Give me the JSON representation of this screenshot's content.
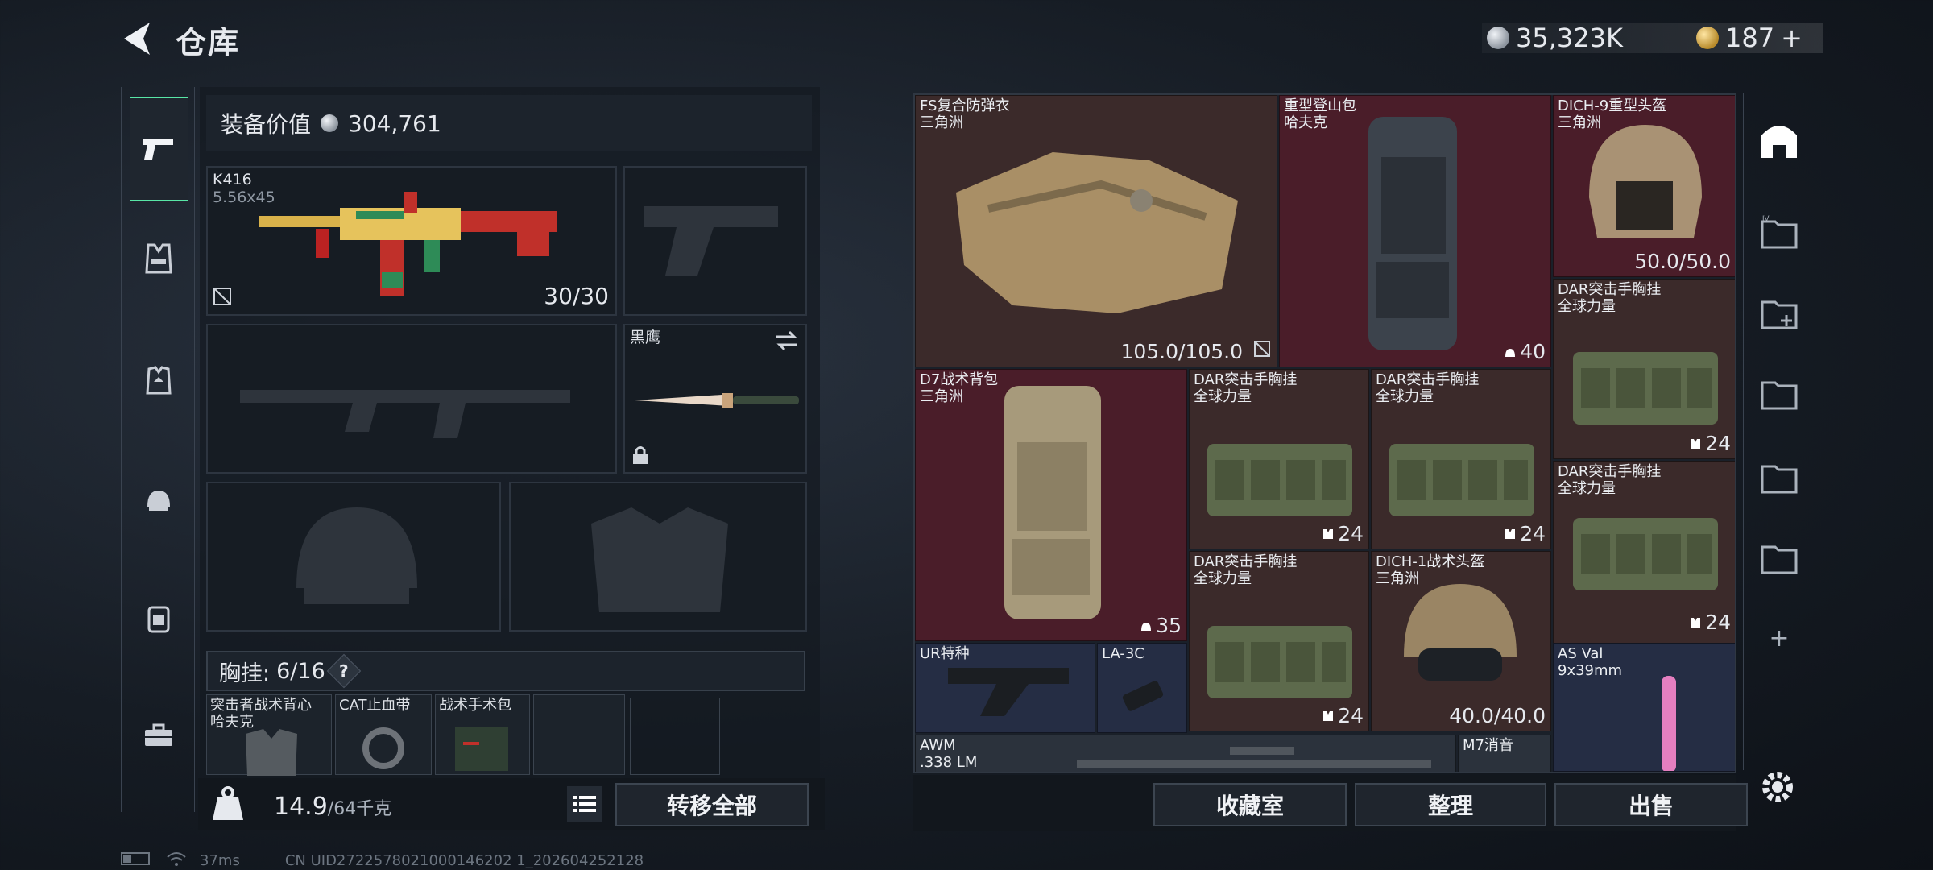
{
  "header": {
    "title": "仓库",
    "currency_silver": "35,323K",
    "currency_gold": "187",
    "gold_plus": "+"
  },
  "loadout": {
    "value_label": "装备价值",
    "value": "304,761",
    "primary_weapon": {
      "name": "K416",
      "caliber": "5.56x45",
      "ammo": "30/30"
    },
    "melee": {
      "name": "黑鹰"
    },
    "chest_rig": {
      "label": "胸挂:",
      "capacity": "6/16",
      "help": "?"
    },
    "chest_items": [
      "突击者战术背心",
      "哈夫克",
      "CAT止血带",
      "战术手术包"
    ],
    "weight": "14.9",
    "weight_max": "/64千克",
    "transfer_all": "转移全部"
  },
  "stash": {
    "items": [
      {
        "name": "FS复合防弹衣",
        "sub": "三角洲",
        "count": "105.0/105.0"
      },
      {
        "name": "重型登山包",
        "sub": "哈夫克",
        "count": "40"
      },
      {
        "name": "DICH-9重型头盔",
        "sub": "三角洲",
        "count": "50.0/50.0"
      },
      {
        "name": "DAR突击手胸挂",
        "sub": "全球力量",
        "count": "24"
      },
      {
        "name": "D7战术背包",
        "sub": "三角洲",
        "count": "35"
      },
      {
        "name": "DAR突击手胸挂",
        "sub": "全球力量",
        "count": "24"
      },
      {
        "name": "DAR突击手胸挂",
        "sub": "全球力量",
        "count": "24"
      },
      {
        "name": "DAR突击手胸挂",
        "sub": "全球力量",
        "count": "24"
      },
      {
        "name": "DAR突击手胸挂",
        "sub": "全球力量",
        "count": "24"
      },
      {
        "name": "DICH-1战术头盔",
        "sub": "三角洲",
        "count": "40.0/40.0"
      },
      {
        "name": "UR特种",
        "sub": "",
        "count": ""
      },
      {
        "name": "LA-3C",
        "sub": "",
        "count": ""
      },
      {
        "name": "AS Val",
        "sub": "9x39mm",
        "count": ""
      },
      {
        "name": "AWM",
        "sub": ".338 LM",
        "count": ""
      },
      {
        "name": "M7消音",
        "sub": "",
        "count": ""
      }
    ],
    "buttons": {
      "collection": "收藏室",
      "sort": "整理",
      "sell": "出售"
    },
    "add": "+"
  },
  "status": {
    "ping": "37ms",
    "uid": "CN UID2722578021000146202 1_202604252128"
  },
  "colors": {
    "accent": "#58e6a6",
    "item_red": "#4a1d29",
    "item_brown": "#3b2a2a",
    "item_navy": "#252d44"
  }
}
